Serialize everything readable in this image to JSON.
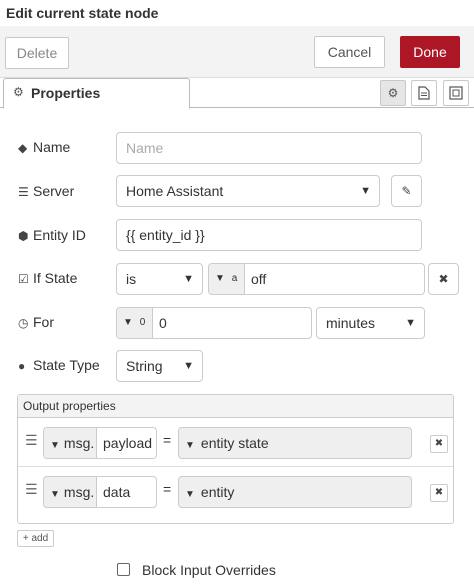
{
  "title": "Edit current state node",
  "toolbar": {
    "delete_label": "Delete",
    "cancel_label": "Cancel",
    "done_label": "Done"
  },
  "tabs": {
    "properties_label": "Properties"
  },
  "form": {
    "name": {
      "label": "Name",
      "placeholder": "Name",
      "value": ""
    },
    "server": {
      "label": "Server",
      "value": "Home Assistant"
    },
    "entity_id": {
      "label": "Entity ID",
      "value": "{{ entity_id }}"
    },
    "if_state": {
      "label": "If State",
      "operator": "is",
      "type_glyph": "a z",
      "value": "off"
    },
    "for": {
      "label": "For",
      "type_glyph": "0 9",
      "value": "0",
      "unit": "minutes"
    },
    "state_type": {
      "label": "State Type",
      "value": "String"
    }
  },
  "output_properties": {
    "header": "Output properties",
    "rows": [
      {
        "prefix": "msg.",
        "property": "payload",
        "equals": "=",
        "value": "entity state"
      },
      {
        "prefix": "msg.",
        "property": "data",
        "equals": "=",
        "value": "entity"
      }
    ],
    "add_label": "add"
  },
  "block_input_overrides": {
    "label": "Block Input Overrides",
    "checked": false
  },
  "colors": {
    "done": "#ad1625",
    "toolbar": "#f3f3f3",
    "border": "#cccccc"
  }
}
